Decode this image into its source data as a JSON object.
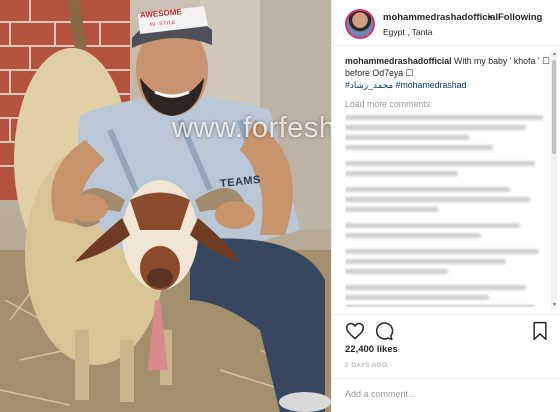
{
  "photo": {
    "watermark": "www.forfesh.com",
    "cap_text": "AWESOME",
    "cap_subtext": "IN · STYLE",
    "shirt_text": "TEAMS"
  },
  "header": {
    "username": "mohammedrashadofficial",
    "separator": "•",
    "follow_label": "Following",
    "location": "Egypt , Tanta"
  },
  "post": {
    "username": "mohammedrashadofficial",
    "caption": " With my baby ' khofa ' ☐ before Od7eya ☐",
    "hashtags": "#محمد_رشاد #mohamedrashad",
    "load_more": "Load more comments"
  },
  "actions": {
    "like_icon": "heart-icon",
    "comment_icon": "comment-bubble-icon",
    "save_icon": "bookmark-icon"
  },
  "stats": {
    "likes": "22,400 likes",
    "timestamp": "2 DAYS AGO"
  },
  "comment_box": {
    "placeholder": "Add a comment..."
  },
  "colors": {
    "link": "#003569",
    "muted": "#999999",
    "text": "#262626",
    "story_ring": "#e1306c"
  }
}
